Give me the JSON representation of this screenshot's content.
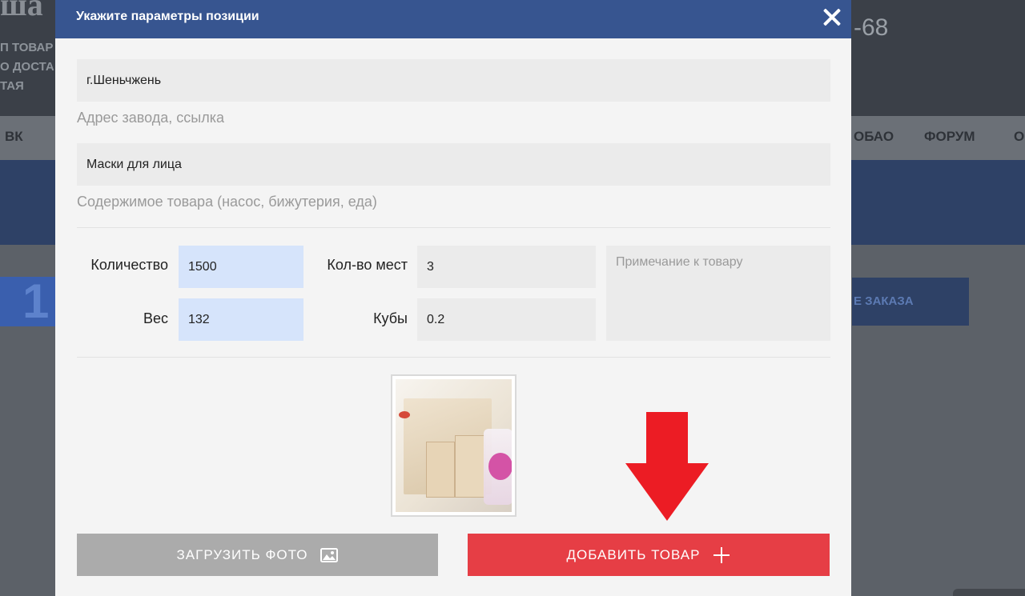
{
  "background": {
    "logo": "ша",
    "left_text_lines": [
      "П ТОВАР",
      "О ДОСТА",
      "ТАЯ"
    ],
    "phone_fragment": "-68",
    "nav_items": [
      "ВК",
      "ОБАО",
      "ФОРУМ",
      "О"
    ],
    "step_number": "1",
    "order_button_fragment": "Е ЗАКАЗА"
  },
  "modal": {
    "title": "Укажите параметры позиции",
    "close_icon": "close-icon",
    "factory_address": {
      "value": "г.Шеньчжень",
      "hint": "Адрес завода, ссылка"
    },
    "contents": {
      "value": "Маски для лица",
      "hint": "Содержимое товара (насос, бижутерия, еда)"
    },
    "quantity": {
      "label": "Количество",
      "value": "1500"
    },
    "places": {
      "label": "Кол-во мест",
      "value": "3"
    },
    "weight": {
      "label": "Вес",
      "value": "132"
    },
    "cubes": {
      "label": "Кубы",
      "value": "0.2"
    },
    "note": {
      "placeholder": "Примечание к товару"
    },
    "upload_button": {
      "label": "ЗАГРУЗИТЬ ФОТО",
      "icon": "image-icon"
    },
    "add_button": {
      "label": "ДОБАВИТЬ ТОВАР",
      "icon": "plus-icon"
    }
  },
  "colors": {
    "header": "#375590",
    "add_button": "#e63e45",
    "upload_button": "#ababab",
    "highlight_field": "#d6e4fb",
    "arrow": "#ec1c24"
  }
}
